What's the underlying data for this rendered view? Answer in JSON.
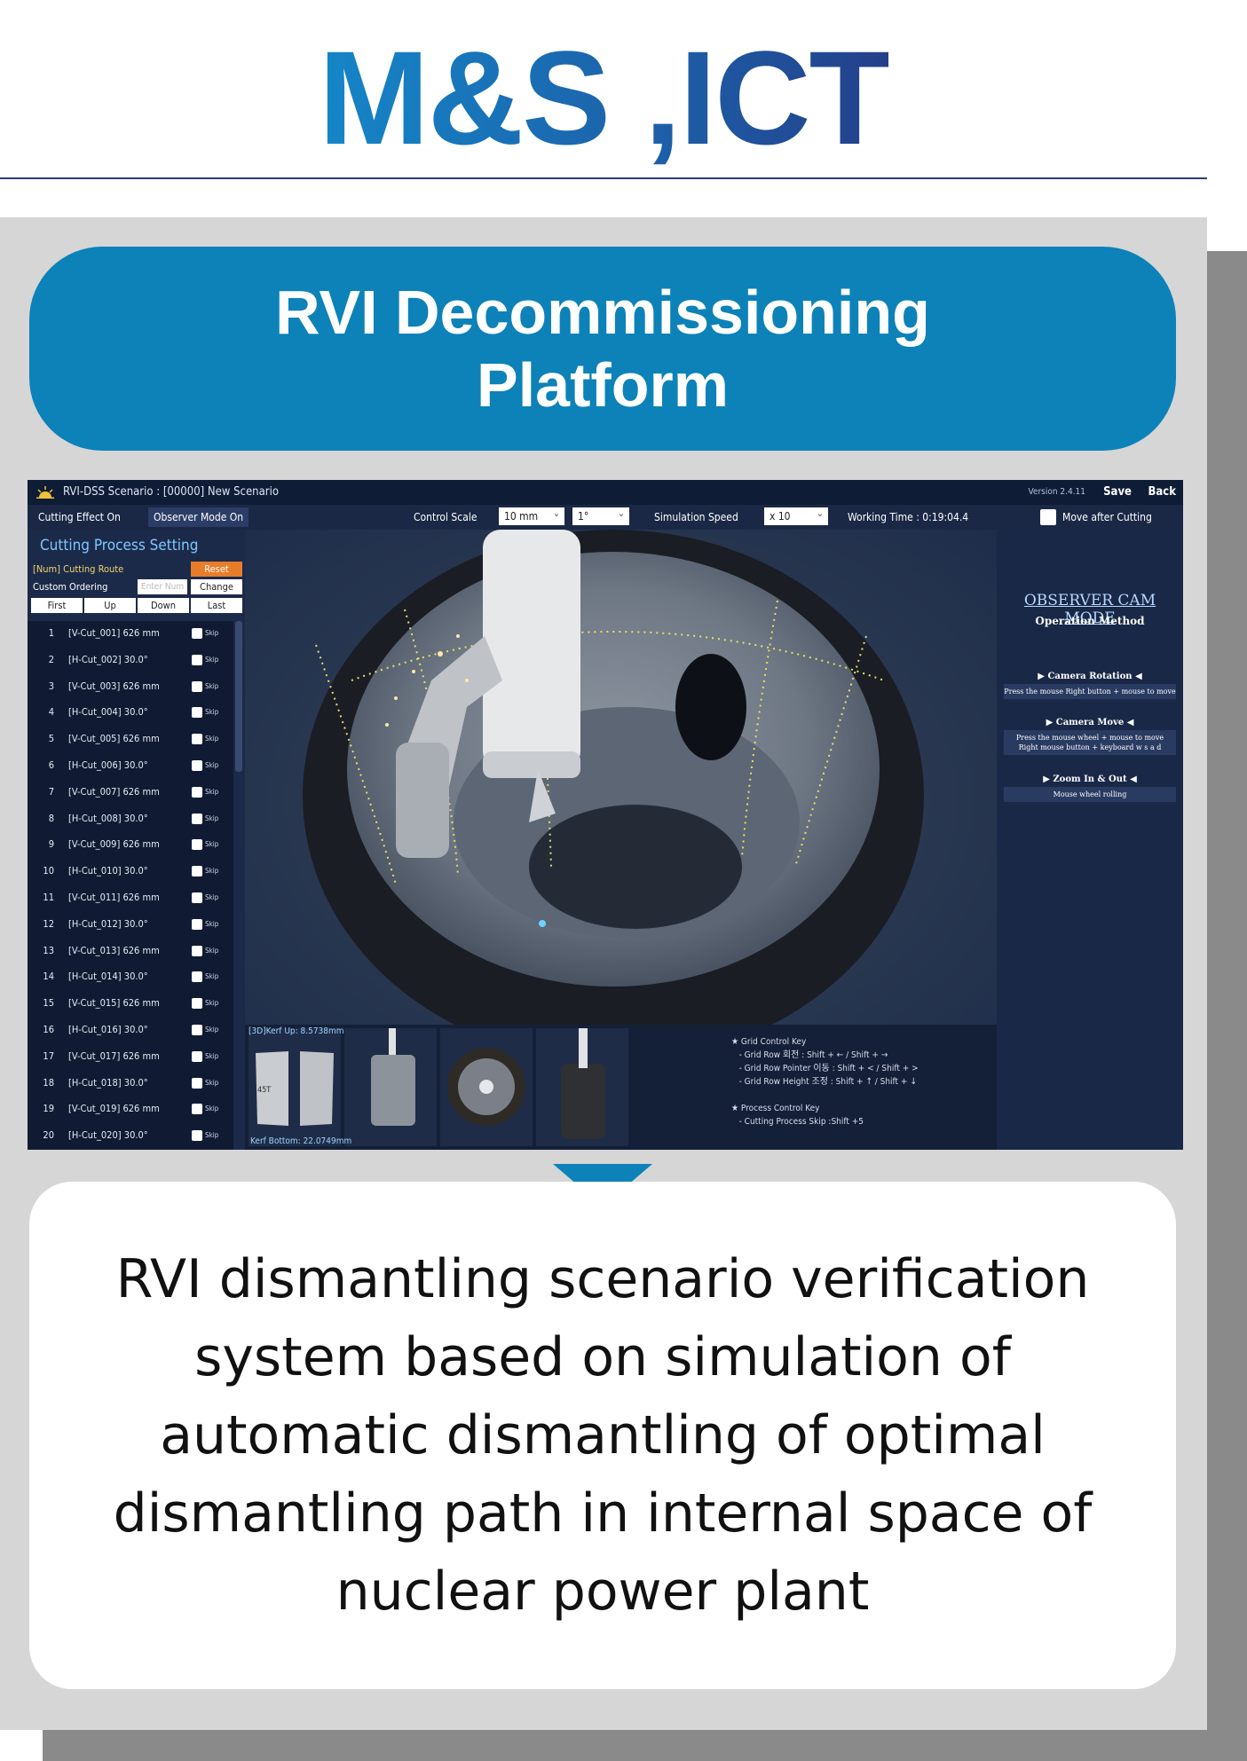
{
  "header": {
    "title": "M&S ,ICT"
  },
  "banner": {
    "line1": "RVI Decommissioning",
    "line2": "Platform"
  },
  "app": {
    "window_title": "RVI-DSS Scenario : [00000] New Scenario",
    "version": "Version 2.4.11",
    "save_label": "Save",
    "back_label": "Back",
    "toolbar": {
      "cutting_effect": "Cutting Effect On",
      "observer_mode": "Observer Mode On",
      "control_scale_label": "Control Scale",
      "control_scale_value": "10 mm",
      "angle_value": "1°",
      "simulation_speed_label": "Simulation Speed",
      "simulation_speed_value": "x 10",
      "working_time": "Working Time : 0:19:04.4",
      "move_after_cutting": "Move after Cutting"
    },
    "left_panel": {
      "title": "Cutting Process Setting",
      "route_label": "[Num] Cutting Route",
      "reset_label": "Reset",
      "custom_ordering_label": "Custom Ordering",
      "enter_placeholder": "Enter Num",
      "change_label": "Change",
      "nav": [
        "First",
        "Up",
        "Down",
        "Last"
      ],
      "skip_label": "Skip",
      "rows": [
        {
          "num": "1",
          "cut": "[V-Cut_001]  626 mm"
        },
        {
          "num": "2",
          "cut": "[H-Cut_002]  30.0°"
        },
        {
          "num": "3",
          "cut": "[V-Cut_003]  626 mm"
        },
        {
          "num": "4",
          "cut": "[H-Cut_004]  30.0°"
        },
        {
          "num": "5",
          "cut": "[V-Cut_005]  626 mm"
        },
        {
          "num": "6",
          "cut": "[H-Cut_006]  30.0°"
        },
        {
          "num": "7",
          "cut": "[V-Cut_007]  626 mm"
        },
        {
          "num": "8",
          "cut": "[H-Cut_008]  30.0°"
        },
        {
          "num": "9",
          "cut": "[V-Cut_009]  626 mm"
        },
        {
          "num": "10",
          "cut": "[H-Cut_010]  30.0°"
        },
        {
          "num": "11",
          "cut": "[V-Cut_011]  626 mm"
        },
        {
          "num": "12",
          "cut": "[H-Cut_012]  30.0°"
        },
        {
          "num": "13",
          "cut": "[V-Cut_013]  626 mm"
        },
        {
          "num": "14",
          "cut": "[H-Cut_014]  30.0°"
        },
        {
          "num": "15",
          "cut": "[V-Cut_015]  626 mm"
        },
        {
          "num": "16",
          "cut": "[H-Cut_016]  30.0°"
        },
        {
          "num": "17",
          "cut": "[V-Cut_017]  626 mm"
        },
        {
          "num": "18",
          "cut": "[H-Cut_018]  30.0°"
        },
        {
          "num": "19",
          "cut": "[V-Cut_019]  626 mm"
        },
        {
          "num": "20",
          "cut": "[H-Cut_020]  30.0°"
        }
      ]
    },
    "right_panel": {
      "title": "OBSERVER CAM MODE",
      "subtitle": "Operation Method",
      "camera_rotation": "▶  Camera Rotation  ◀",
      "camera_rotation_desc": "Press the mouse Right button + mouse to move",
      "camera_move": "▶  Camera Move  ◀",
      "camera_move_desc1": "Press the mouse wheel + mouse to move",
      "camera_move_desc2": "Right mouse button + keyboard w s a d",
      "zoom": "▶  Zoom In & Out  ◀",
      "zoom_desc": "Mouse wheel rolling"
    },
    "bottom": {
      "kerf_up": "[3D]Kerf Up: 8.5738mm",
      "kerf_bottom": "Kerf Bottom: 22.0749mm",
      "thumb_label": "45T",
      "info": "★ Grid Control Key\n   - Grid Row 회전 : Shift + ← / Shift + →\n   - Grid Row Pointer 이동 : Shift + < / Shift + >\n   - Grid Row Height 조정 : Shift + ↑ / Shift + ↓\n\n★ Process Control Key\n   - Cutting Process Skip :Shift +5"
    }
  },
  "description": "RVI dismantling scenario verification system based on simulation of automatic dismantling of optimal dismantling path in internal space of nuclear power plant"
}
